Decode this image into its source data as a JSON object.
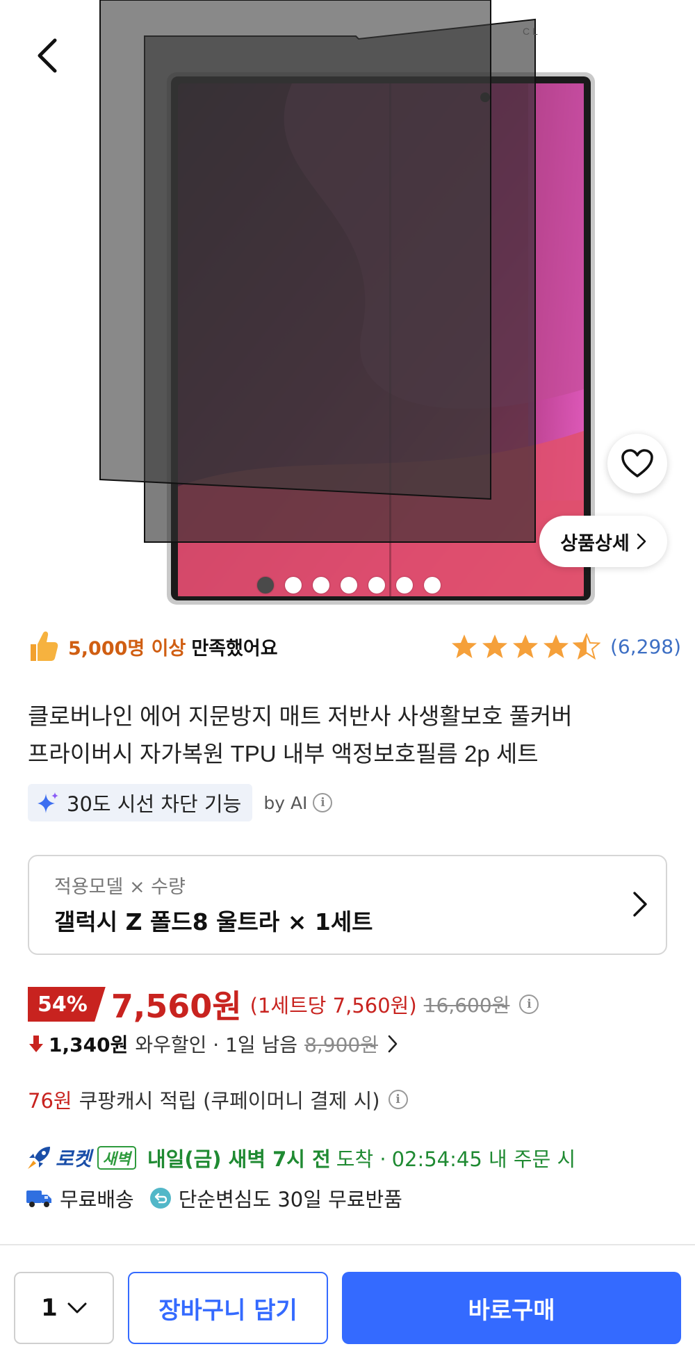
{
  "header": {
    "back_icon": "chevron-left-icon"
  },
  "hero": {
    "slide_count": 7,
    "active_slide": 1,
    "wishlist_icon": "heart-outline-icon",
    "detail_button_label": "상품상세"
  },
  "rating": {
    "satisfaction_count": "5,000명 이상",
    "satisfaction_text": "만족했어요",
    "stars": 4.5,
    "review_count": "(6,298)"
  },
  "product": {
    "title_line1": "클로버나인 에어 지문방지 매트 저반사 사생활보호 풀커버",
    "title_line2": "프라이버시 자가복원 TPU 내부 액정보호필름 2p 세트",
    "ai_feature": "30도 시선 차단 기능",
    "ai_source": "by AI"
  },
  "option": {
    "label": "적용모델 × 수량",
    "value": "갤럭시 Z 폴드8 울트라 × 1세트"
  },
  "price": {
    "discount": "54%",
    "sale": "7,560원",
    "per_unit": "(1세트당 7,560원)",
    "original": "16,600원",
    "wow_amount": "1,340원",
    "wow_label": "와우할인 · 1일 남음",
    "wow_original": "8,900원",
    "cash_amount": "76원",
    "cash_label": "쿠팡캐시 적립 (쿠페이머니 결제 시)"
  },
  "delivery": {
    "rocket_label": "로켓",
    "rocket_badge": "새벽",
    "arrival_strong": "내일(금) 새벽 7시 전",
    "arrival_rest": "도착 ·",
    "deadline": "02:54:45 내 주문 시",
    "free_shipping": "무료배송",
    "free_return": "단순변심도 30일 무료반품"
  },
  "bottom": {
    "quantity": "1",
    "cart_label": "장바구니 담기",
    "buy_label": "바로구매"
  },
  "colors": {
    "accent_blue": "#346aff",
    "sale_red": "#c8231f",
    "rocket_green": "#1f8a32",
    "star_orange": "#f5a03a"
  }
}
